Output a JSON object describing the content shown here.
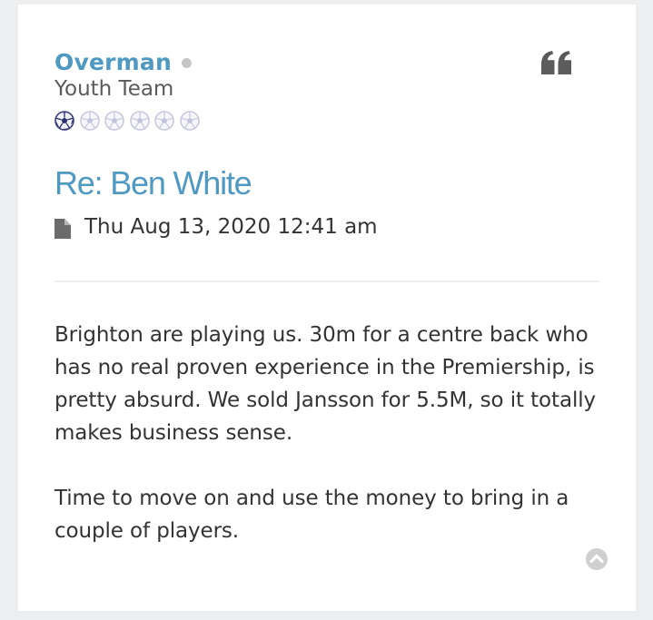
{
  "post": {
    "author": {
      "username": "Overman",
      "status": "offline",
      "rank_title": "Youth Team",
      "rank_balls_total": 6,
      "rank_balls_filled": 1,
      "rank_ball_icon": "football-icon"
    },
    "quote_icon": "quote-icon",
    "title": "Re: Ben White",
    "post_icon": "document-icon",
    "date": "Thu Aug 13, 2020 12:41 am",
    "body": [
      "Brighton are playing us. 30m for a centre back who has no real proven experience in the Premiership, is pretty absurd. We sold Jansson for 5.5M, so it totally makes business sense.",
      "Time to move on and use the money to bring in a couple of players."
    ],
    "back_to_top_icon": "chevron-up-circle-icon"
  },
  "colors": {
    "accent": "#4f99c2",
    "text": "#333333",
    "muted": "#5b5b5b",
    "status_dot": "#c6c6c6",
    "icon_gray": "#5c5c5c",
    "page_bg": "#eceeef"
  }
}
